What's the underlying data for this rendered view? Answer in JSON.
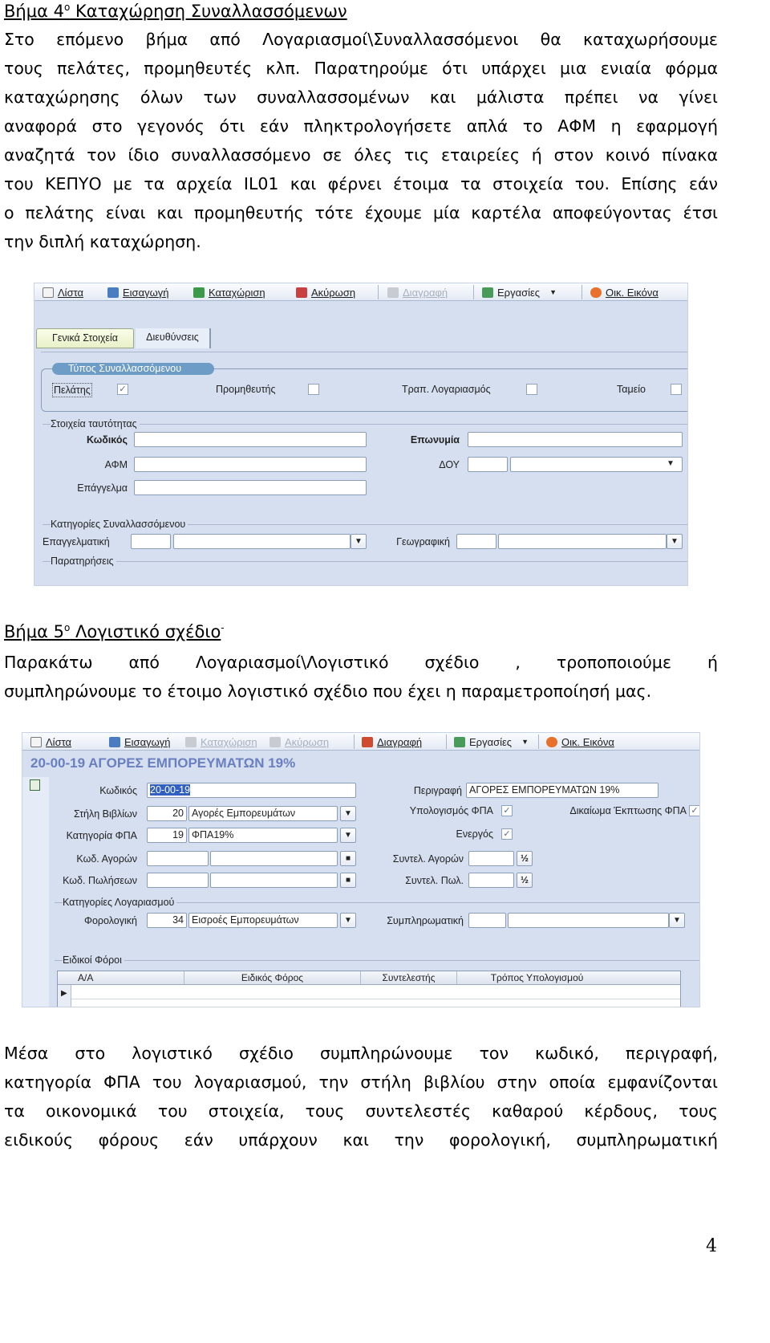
{
  "step4": {
    "heading_prefix": "Βήμα 4",
    "heading_sup": "ο",
    "heading_title": " Καταχώρηση Συναλλασσόμενων",
    "lines": [
      "Στο επόμενο βήμα από Λογαριασμοί\\Συναλλασσόμενοι θα καταχωρήσουμε",
      "τους πελάτες, προμηθευτές κλπ. Παρατηρούμε ότι υπάρχει μια ενιαία φόρμα",
      "καταχώρησης όλων των συναλλασσομένων και μάλιστα πρέπει να γίνει",
      "αναφορά στο γεγονός ότι εάν πληκτρολογήσετε απλά το ΑΦΜ η εφαρμογή",
      "αναζητά τον ίδιο συναλλασσόμενο σε όλες τις εταιρείες ή στον κοινό πίνακα",
      "του ΚΕΠΥΟ με τα αρχεία IL01 και φέρνει έτοιμα τα στοιχεία του. Επίσης εάν",
      "ο πελάτης είναι και προμηθευτής τότε έχουμε μία καρτέλα αποφεύγοντας έτσι",
      "την διπλή καταχώρηση."
    ]
  },
  "screenshot1": {
    "toolbar": {
      "list": "Λίστα",
      "insert": "Εισαγωγή",
      "save": "Καταχώριση",
      "cancel": "Ακύρωση",
      "delete": "Διαγραφή",
      "tasks": "Εργασίες",
      "financial": "Οικ. Εικόνα"
    },
    "tabs": [
      "Γενικά Στοιχεία",
      "Διευθύνσεις"
    ],
    "type_group": {
      "title": "Τύπος Συναλλασσόμενου",
      "customer": "Πελάτης",
      "customer_checked": true,
      "supplier": "Προμηθευτής",
      "supplier_checked": false,
      "bank": "Τραπ. Λογαριασμός",
      "bank_checked": false,
      "cash": "Ταμείο",
      "cash_checked": false
    },
    "identity": {
      "title": "Στοιχεία ταυτότητας",
      "code": "Κωδικός",
      "name": "Επωνυμία",
      "vat": "ΑΦΜ",
      "tax_office": "ΔΟΥ",
      "profession": "Επάγγελμα"
    },
    "categories": {
      "title": "Κατηγορίες Συναλλασσόμενου",
      "professional": "Επαγγελματική",
      "geographic": "Γεωγραφική"
    },
    "notes": "Παρατηρήσεις"
  },
  "step5": {
    "heading_prefix": "Βήμα 5",
    "heading_sup": "ο",
    "heading_title": " Λογιστικό σχέδιο",
    "heading_dash": "-",
    "lines": [
      "Παρακάτω από Λογαριασμοί\\Λογιστικό σχέδιο , τροποποιούμε ή",
      "συμπληρώνουμε το έτοιμο λογιστικό σχέδιο που έχει η παραμετροποίησή μας."
    ]
  },
  "screenshot2": {
    "toolbar": {
      "list": "Λίστα",
      "insert": "Εισαγωγή",
      "save": "Καταχώριση",
      "cancel": "Ακύρωση",
      "delete": "Διαγραφή",
      "tasks": "Εργασίες",
      "financial": "Οικ. Εικόνα"
    },
    "title": "20-00-19 ΑΓΟΡΕΣ ΕΜΠΟΡΕΥΜΑΤΩΝ 19%",
    "title_color": "#6a7fc0",
    "code_label": "Κωδικός",
    "code_value": "20-00-19",
    "description_label": "Περιγραφή",
    "description_value": "ΑΓΟΡΕΣ ΕΜΠΟΡΕΥΜΑΤΩΝ 19%",
    "book_column_label": "Στήλη Βιβλίων",
    "book_column_code": "20",
    "book_column_value": "Αγορές Εμπορευμάτων",
    "vat_calc_label": "Υπολογισμός ΦΠΑ",
    "vat_calc_checked": true,
    "vat_deduct_label": "Δικαίωμα Έκπτωσης ΦΠΑ",
    "vat_deduct_checked": true,
    "vat_category_label": "Κατηγορία ΦΠΑ",
    "vat_category_code": "19",
    "vat_category_value": "ΦΠΑ19%",
    "active_label": "Ενεργός",
    "active_checked": true,
    "purchase_code_label": "Κωδ. Αγορών",
    "purchase_rate_label": "Συντελ. Αγορών",
    "sales_code_label": "Κωδ. Πωλήσεων",
    "sales_rate_label": "Συντελ. Πωλ.",
    "rate_button": "½",
    "categories_title": "Κατηγορίες Λογαριασμού",
    "tax_label": "Φορολογική",
    "tax_code": "34",
    "tax_value": "Εισροές Εμπορευμάτων",
    "supplementary_label": "Συμπληρωματική",
    "special_taxes_title": "Ειδικοί Φόροι",
    "grid_columns": [
      "Α/Α",
      "Ειδικός Φόρος",
      "Συντελεστής",
      "Τρόπος Υπολογισμού"
    ]
  },
  "closing": {
    "lines": [
      "Μέσα στο λογιστικό σχέδιο συμπληρώνουμε τον κωδικό, περιγραφή,",
      "κατηγορία ΦΠΑ του λογαριασμού, την στήλη βιβλίου στην οποία εμφανίζονται",
      "τα οικονομικά του στοιχεία, τους συντελεστές καθαρού κέρδους, τους",
      "ειδικούς φόρους εάν υπάρχουν και την φορολογική, συμπληρωματική"
    ]
  },
  "page_number": "4"
}
